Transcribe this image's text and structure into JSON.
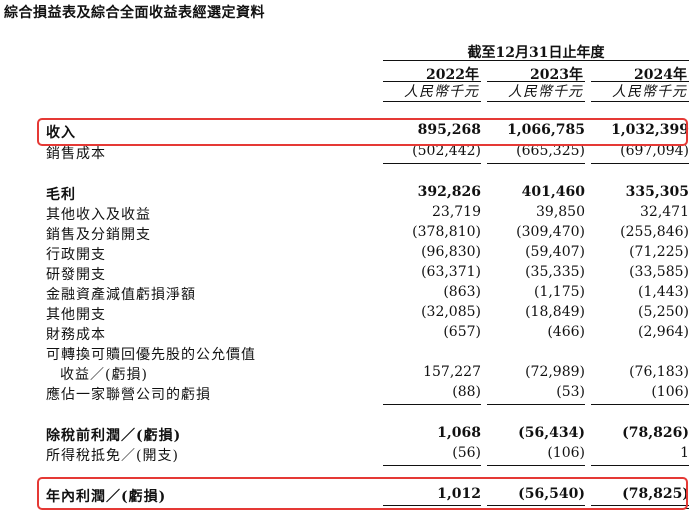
{
  "title": "綜合損益表及綜合全面收益表經選定資料",
  "header": {
    "period": "截至12月31日止年度",
    "years": [
      "2022年",
      "2023年",
      "2024年"
    ],
    "unit": "人民幣千元"
  },
  "rows": [
    {
      "label": "收入",
      "bold": true,
      "values": [
        "895,268",
        "1,066,785",
        "1,032,399"
      ]
    },
    {
      "label": "銷售成本",
      "bold": false,
      "values": [
        "(502,442)",
        "(665,325)",
        "(697,094)"
      ]
    },
    {
      "label": "毛利",
      "bold": true,
      "values": [
        "392,826",
        "401,460",
        "335,305"
      ]
    },
    {
      "label": "其他收入及收益",
      "bold": false,
      "values": [
        "23,719",
        "39,850",
        "32,471"
      ]
    },
    {
      "label": "銷售及分銷開支",
      "bold": false,
      "values": [
        "(378,810)",
        "(309,470)",
        "(255,846)"
      ]
    },
    {
      "label": "行政開支",
      "bold": false,
      "values": [
        "(96,830)",
        "(59,407)",
        "(71,225)"
      ]
    },
    {
      "label": "研發開支",
      "bold": false,
      "values": [
        "(63,371)",
        "(35,335)",
        "(33,585)"
      ]
    },
    {
      "label": "金融資產減值虧損淨額",
      "bold": false,
      "values": [
        "(863)",
        "(1,175)",
        "(1,443)"
      ]
    },
    {
      "label": "其他開支",
      "bold": false,
      "values": [
        "(32,085)",
        "(18,849)",
        "(5,250)"
      ]
    },
    {
      "label": "財務成本",
      "bold": false,
      "values": [
        "(657)",
        "(466)",
        "(2,964)"
      ]
    },
    {
      "label": "可轉換可贖回優先股的公允價值",
      "bold": false,
      "values": []
    },
    {
      "label": "收益／(虧損)",
      "bold": false,
      "values": [
        "157,227",
        "(72,989)",
        "(76,183)"
      ]
    },
    {
      "label": "應佔一家聯營公司的虧損",
      "bold": false,
      "values": [
        "(88)",
        "(53)",
        "(106)"
      ]
    },
    {
      "label": "除稅前利潤／(虧損)",
      "bold": true,
      "values": [
        "1,068",
        "(56,434)",
        "(78,826)"
      ]
    },
    {
      "label": "所得稅抵免／(開支)",
      "bold": false,
      "values": [
        "(56)",
        "(106)",
        "1"
      ]
    },
    {
      "label": "年內利潤／(虧損)",
      "bold": true,
      "values": [
        "1,012",
        "(56,540)",
        "(78,825)"
      ]
    }
  ]
}
